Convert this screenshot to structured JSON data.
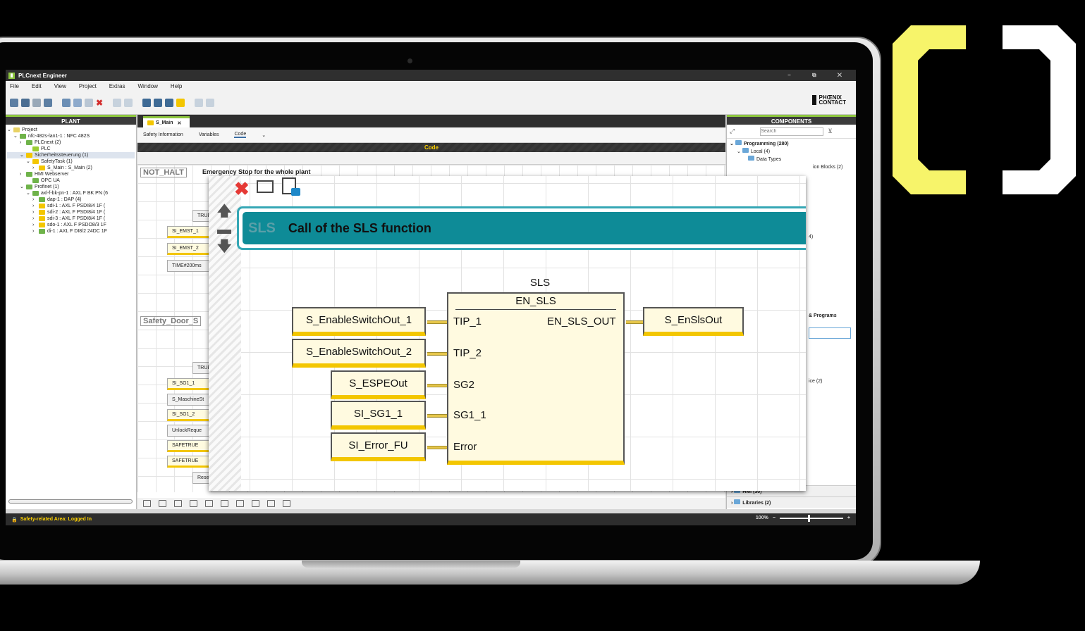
{
  "app": {
    "title": "PLCnext Engineer",
    "window_controls": "–  ⧉  ✕",
    "brand": "PHŒNIX\nCONTACT"
  },
  "menu": [
    "File",
    "Edit",
    "View",
    "Project",
    "Extras",
    "Window",
    "Help"
  ],
  "plant": {
    "header": "PLANT",
    "tree": [
      {
        "label": "Project",
        "indent": 0,
        "expanded": true,
        "icon_color": "#e8d264"
      },
      {
        "label": "nfc-482s-lan1-1 : NFC 482S",
        "indent": 1,
        "expanded": true,
        "icon_color": "#6fb34a"
      },
      {
        "label": "PLCnext (2)",
        "indent": 2,
        "expanded": false,
        "icon_color": "#6fb34a"
      },
      {
        "label": "PLC",
        "indent": 3,
        "expanded": null,
        "icon_color": "#9acd32"
      },
      {
        "label": "Sicherheitssteuerung (1)",
        "indent": 2,
        "expanded": true,
        "icon_color": "#f3c600",
        "selected": true
      },
      {
        "label": "SafetyTask (1)",
        "indent": 3,
        "expanded": true,
        "icon_color": "#f3c600"
      },
      {
        "label": "S_Main : S_Main (2)",
        "indent": 4,
        "expanded": false,
        "icon_color": "#f3c600"
      },
      {
        "label": "HMI Webserver",
        "indent": 2,
        "expanded": false,
        "icon_color": "#6fb34a"
      },
      {
        "label": "OPC UA",
        "indent": 3,
        "expanded": null,
        "icon_color": "#6fb34a"
      },
      {
        "label": "Profinet (1)",
        "indent": 2,
        "expanded": true,
        "icon_color": "#6fb34a"
      },
      {
        "label": "axl-f-bk-pn-1 : AXL F BK PN (6",
        "indent": 3,
        "expanded": true,
        "icon_color": "#6fb34a"
      },
      {
        "label": "dap-1 : DAP (4)",
        "indent": 4,
        "expanded": false,
        "icon_color": "#6fb34a"
      },
      {
        "label": "sdi-1 : AXL F PSDI8/4 1F (",
        "indent": 4,
        "expanded": false,
        "icon_color": "#f3c600"
      },
      {
        "label": "sdi-2 : AXL F PSDI8/4 1F (",
        "indent": 4,
        "expanded": false,
        "icon_color": "#f3c600"
      },
      {
        "label": "sdi-3 : AXL F PSDI8/4 1F (",
        "indent": 4,
        "expanded": false,
        "icon_color": "#f3c600"
      },
      {
        "label": "sdo-1 : AXL F PSDO8/3 1F",
        "indent": 4,
        "expanded": false,
        "icon_color": "#f3c600"
      },
      {
        "label": "di-1 : AXL F DI8/2 24DC 1F",
        "indent": 4,
        "expanded": false,
        "icon_color": "#6fb34a"
      }
    ]
  },
  "editor": {
    "tab": "S_Main",
    "subtabs": [
      "Safety Information",
      "Variables",
      "Code"
    ],
    "code_header": "Code",
    "network1": {
      "label": "NOT_HALT",
      "comment": "Emergency Stop for the whole plant"
    },
    "network2": {
      "label": "Safety_Door_S"
    },
    "bg_vars": [
      "TRUE",
      "SI_EMST_1",
      "SI_EMST_2",
      "TIME#200ms",
      "TRUE",
      "SI_SG1_1",
      "S_MaschineSt",
      "SI_SG1_2",
      "UnlockReque",
      "SAFETRUE",
      "SAFETRUE",
      "Rese"
    ]
  },
  "components": {
    "header": "COMPONENTS",
    "search_placeholder": "Search",
    "items": [
      "Programming (280)",
      "Local (4)",
      "Data Types",
      "ion Blocks (2)"
    ],
    "fragments": [
      "4)",
      "& Programs",
      "ice (2)"
    ],
    "bottom": [
      "HMI (30)",
      "Libraries (2)"
    ]
  },
  "status": {
    "text": "Safety-related Area: Logged In",
    "zoom": "100%"
  },
  "zoom_view": {
    "comment_key": "SLS",
    "comment_text": "Call of the SLS function",
    "fb_instance": "SLS",
    "fb_type": "EN_SLS",
    "inputs": [
      {
        "pin": "TIP_1",
        "var": "S_EnableSwitchOut_1"
      },
      {
        "pin": "TIP_2",
        "var": "S_EnableSwitchOut_2"
      },
      {
        "pin": "SG2",
        "var": "S_ESPEOut"
      },
      {
        "pin": "SG1_1",
        "var": "SI_SG1_1"
      },
      {
        "pin": "Error",
        "var": "SI_Error_FU"
      }
    ],
    "outputs": [
      {
        "pin": "EN_SLS_OUT",
        "var": "S_EnSlsOut"
      }
    ]
  },
  "colors": {
    "accent_green": "#8dc63f",
    "safety_yellow": "#f3c600",
    "comment_teal": "#0e8b97",
    "bracket_yellow": "#f7f46a"
  }
}
